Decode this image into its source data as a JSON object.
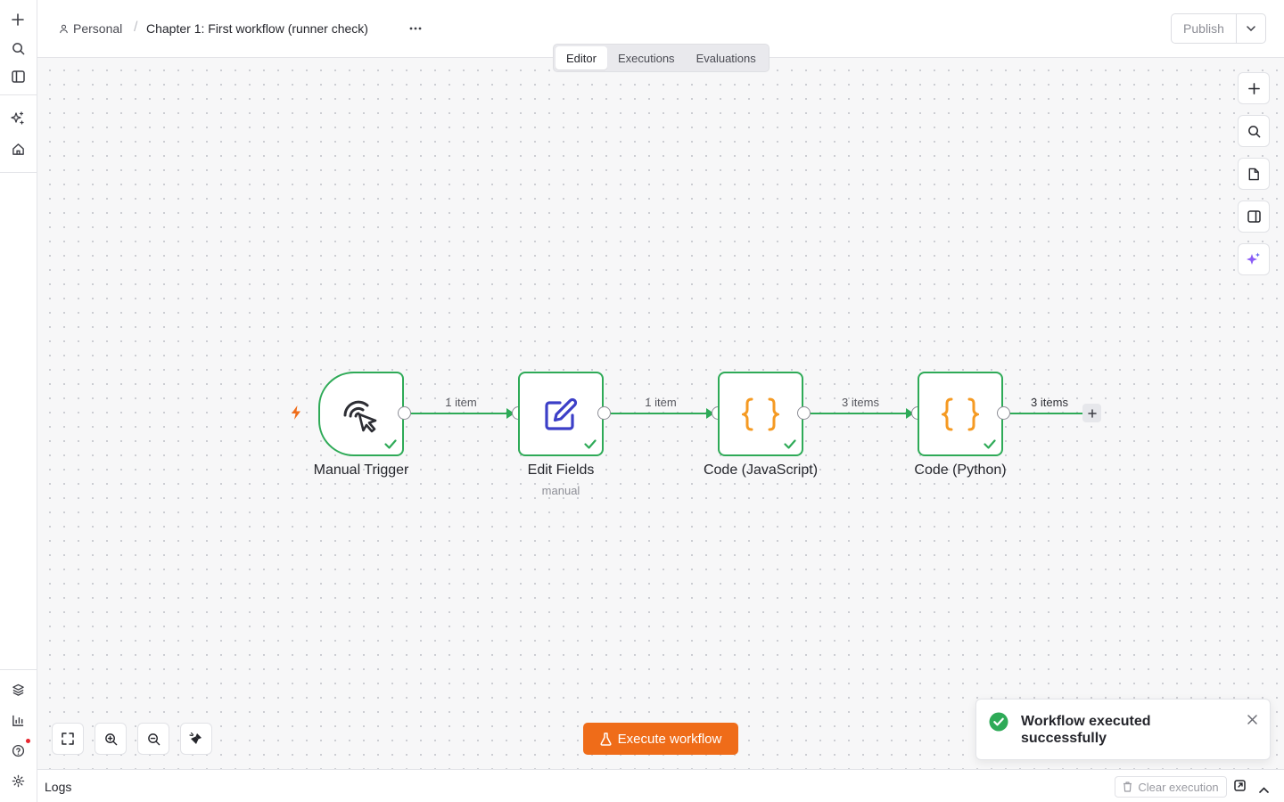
{
  "header": {
    "project": "Personal",
    "separator": "/",
    "workflow_title": "Chapter 1: First workflow (runner check)",
    "publish_label": "Publish"
  },
  "tabs": [
    {
      "label": "Editor",
      "active": true
    },
    {
      "label": "Executions",
      "active": false
    },
    {
      "label": "Evaluations",
      "active": false
    }
  ],
  "nodes": [
    {
      "label": "Manual Trigger",
      "subtitle": "",
      "icon": "cursor-click-icon",
      "status": "success"
    },
    {
      "label": "Edit Fields",
      "subtitle": "manual",
      "icon": "edit-pen-icon",
      "status": "success"
    },
    {
      "label": "Code (JavaScript)",
      "subtitle": "",
      "icon": "code-braces-icon",
      "status": "success"
    },
    {
      "label": "Code (Python)",
      "subtitle": "",
      "icon": "code-braces-icon",
      "status": "success"
    }
  ],
  "connections": [
    {
      "label": "1 item"
    },
    {
      "label": "1 item"
    },
    {
      "label": "3 items"
    },
    {
      "label": "3 items"
    }
  ],
  "execute_button": "Execute workflow",
  "toast": {
    "message": "Workflow executed successfully",
    "status": "success"
  },
  "logs": {
    "title": "Logs",
    "clear_label": "Clear execution"
  },
  "colors": {
    "success": "#2eaa57",
    "accent": "#ef6c19",
    "edit_icon": "#3c3fc7",
    "code_icon": "#f59a23",
    "ai_icon": "#8b5cf6"
  }
}
